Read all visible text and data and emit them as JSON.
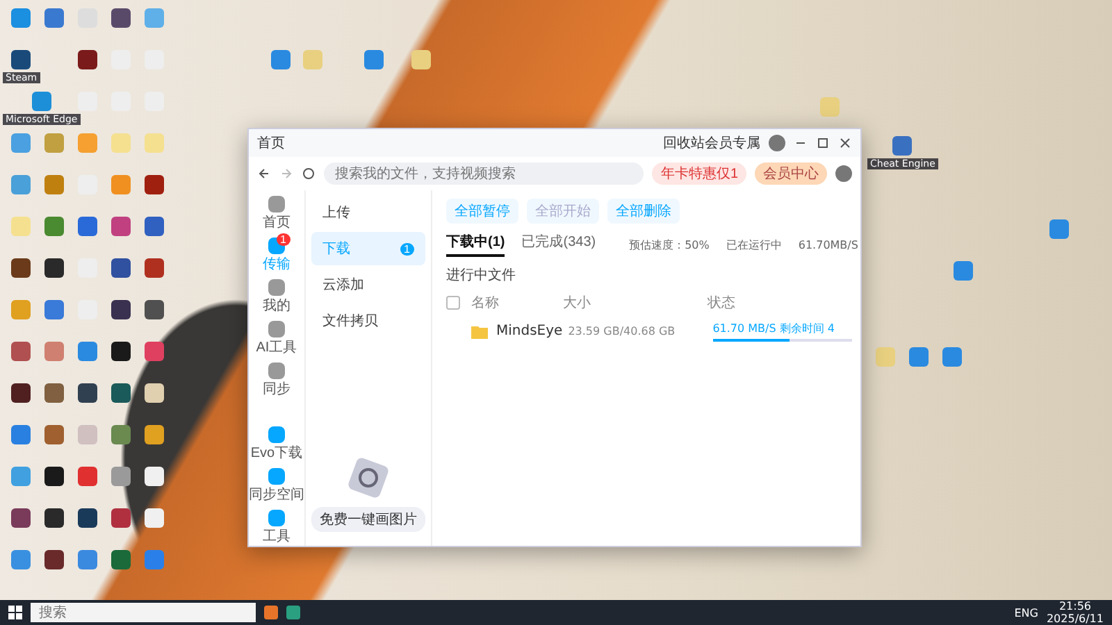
{
  "desktop": {
    "labeled_icons": [
      {
        "label": "Steam"
      },
      {
        "label": "Microsoft Edge"
      },
      {
        "label": "Cheat Engine"
      }
    ]
  },
  "window": {
    "title": "首页",
    "top_link": "回收站会员专属",
    "search": {
      "placeholder": "搜索我的文件，支持视频搜索"
    },
    "promo_buttons": [
      "年卡特惠仅1",
      "会员中心"
    ],
    "rail": [
      {
        "label": "首页",
        "selected": false
      },
      {
        "label": "传输",
        "selected": true,
        "badge": "1"
      },
      {
        "label": "我的",
        "selected": false
      },
      {
        "label": "AI工具",
        "selected": false
      },
      {
        "label": "同步",
        "selected": false
      }
    ],
    "rail_bottom": [
      "Evo下载",
      "同步空间",
      "工具"
    ],
    "sidebar": [
      {
        "label": "上传",
        "selected": false
      },
      {
        "label": "下载",
        "selected": true,
        "badge": "1"
      },
      {
        "label": "云添加",
        "selected": false
      },
      {
        "label": "文件拷贝",
        "selected": false
      }
    ],
    "promo_card": {
      "label": "免费一键画图片"
    },
    "actions": [
      {
        "label": "全部暂停",
        "disabled": false
      },
      {
        "label": "全部开始",
        "disabled": true
      },
      {
        "label": "全部删除",
        "disabled": false
      }
    ],
    "tabs": [
      {
        "label": "下载中(1)",
        "selected": true
      },
      {
        "label": "已完成(343)",
        "selected": false
      }
    ],
    "speed_info": [
      "预估速度：50%",
      "已在运行中",
      "61.70MB/S"
    ],
    "section_title": "进行中文件",
    "select_all": {
      "checked": false
    },
    "columns": [
      "名称",
      "大小",
      "状态"
    ],
    "rows": [
      {
        "name": "MindsEye",
        "size": "23.59 GB/40.68 GB",
        "status": "61.70 MB/S 剩余时间 4",
        "level": 0.55
      }
    ]
  },
  "taskbar": {
    "search_placeholder": "搜索",
    "language": "ENG",
    "time": "21:56",
    "date": "2025/6/11"
  }
}
